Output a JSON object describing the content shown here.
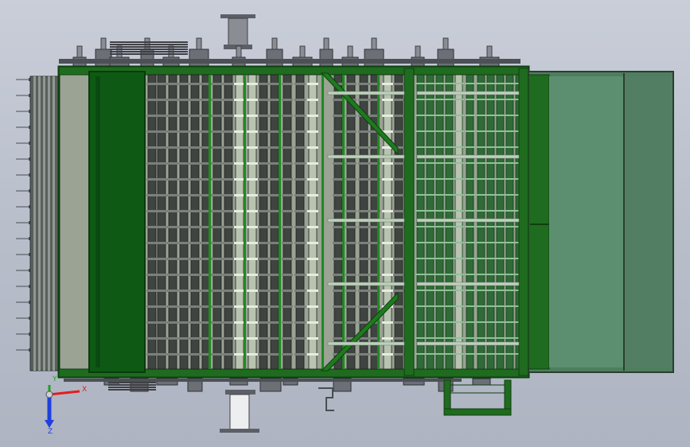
{
  "viewport": {
    "background_top": "#c9ced9",
    "background_bottom": "#aeb4c1",
    "frame_color": "#1f6b1f",
    "frame_dark": "#0f3f10",
    "panel_color": "#0e5a14",
    "hopper_color": "#4f7d60",
    "roller_color": "#b9c4b0",
    "shaft_color": "#6b6f6b"
  },
  "model": {
    "rows": 18,
    "roller_columns": 16,
    "crossbars": 2
  },
  "triad": {
    "x_label": "X",
    "y_label": "Y",
    "z_label": "Z",
    "x_color": "#e01f1f",
    "y_color": "#1fa11f",
    "z_color": "#1f3fe0"
  }
}
